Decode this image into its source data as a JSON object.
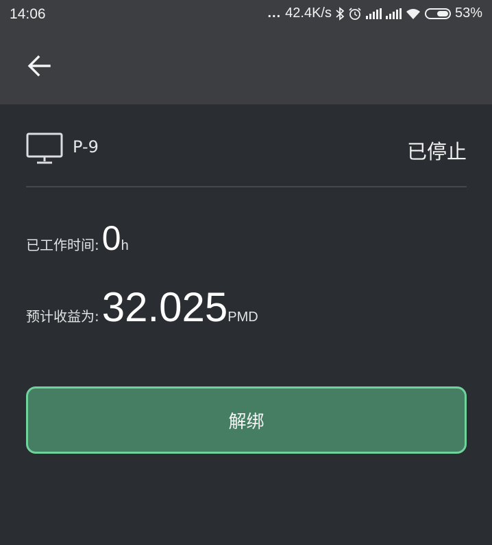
{
  "status_bar": {
    "time": "14:06",
    "dots": "...",
    "network_speed": "42.4K/s",
    "battery_percent": "53%",
    "icons": [
      "bluetooth-icon",
      "alarm-icon",
      "signal-icon",
      "signal-icon",
      "wifi-icon",
      "battery-icon"
    ]
  },
  "app_bar": {
    "back_icon": "arrow-left-icon"
  },
  "device": {
    "icon": "monitor-icon",
    "name": "P-9",
    "status": "已停止"
  },
  "metrics": {
    "work_time": {
      "label": "已工作时间:",
      "value": "0",
      "unit": "h"
    },
    "expected_income": {
      "label": "预计收益为:",
      "value": "32.025",
      "unit": "PMD"
    }
  },
  "actions": {
    "unbind_label": "解绑"
  },
  "colors": {
    "background": "#2a2d31",
    "bars": "#3c3e42",
    "button_fill": "#467e64",
    "button_border": "#6fd39b",
    "divider": "#44474c"
  }
}
